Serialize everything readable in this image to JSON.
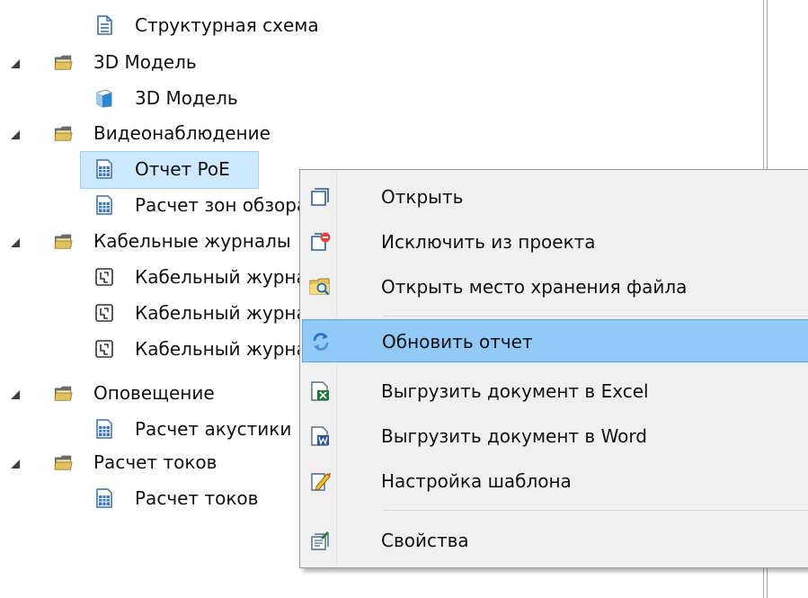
{
  "tree": {
    "items": [
      {
        "label": "Структурная схема"
      },
      {
        "label": "3D Модель"
      },
      {
        "label": "3D Модель"
      },
      {
        "label": "Видеонаблюдение"
      },
      {
        "label": "Отчет PoE"
      },
      {
        "label": "Расчет зон обзора"
      },
      {
        "label": "Кабельные журналы"
      },
      {
        "label": "Кабельный журнал"
      },
      {
        "label": "Кабельный журнал"
      },
      {
        "label": "Кабельный журнал"
      },
      {
        "label": "Оповещение"
      },
      {
        "label": "Расчет акустики"
      },
      {
        "label": "Расчет токов"
      },
      {
        "label": "Расчет токов"
      }
    ]
  },
  "context_menu": {
    "items": [
      {
        "label": "Открыть",
        "icon": "open-document-icon"
      },
      {
        "label": "Исключить из проекта",
        "icon": "exclude-from-project-icon"
      },
      {
        "label": "Открыть место хранения файла",
        "icon": "open-file-location-icon"
      },
      {
        "label": "Обновить отчет",
        "icon": "refresh-icon"
      },
      {
        "label": "Выгрузить документ в Excel",
        "icon": "excel-export-icon"
      },
      {
        "label": "Выгрузить документ в Word",
        "icon": "word-export-icon"
      },
      {
        "label": "Настройка шаблона",
        "icon": "template-settings-icon"
      },
      {
        "label": "Свойства",
        "icon": "properties-icon"
      }
    ]
  },
  "colors": {
    "selection": "#cde8ff",
    "menu_background": "#f0f0f0",
    "menu_highlight": "#91c9f7"
  }
}
